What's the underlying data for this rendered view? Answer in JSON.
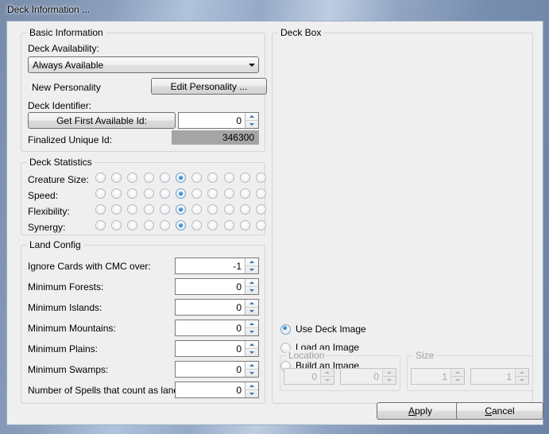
{
  "window": {
    "title": "Deck Information ..."
  },
  "basic_information": {
    "legend": "Basic Information",
    "availability_label": "Deck Availability:",
    "availability_value": "Always Available",
    "personality_label": "New Personality",
    "edit_personality_button": "Edit Personality ...",
    "deck_identifier_label": "Deck Identifier:",
    "get_first_available_button": "Get First Available Id:",
    "deck_identifier_value": "0",
    "finalized_label": "Finalized Unique Id:",
    "finalized_value": "346300"
  },
  "deck_statistics": {
    "legend": "Deck Statistics",
    "columns": 11,
    "rows": [
      {
        "label": "Creature Size:",
        "selected_index": 5
      },
      {
        "label": "Speed:",
        "selected_index": 5
      },
      {
        "label": "Flexibility:",
        "selected_index": 5
      },
      {
        "label": "Synergy:",
        "selected_index": 5
      }
    ]
  },
  "land_config": {
    "legend": "Land Config",
    "fields": [
      {
        "label": "Ignore Cards with CMC over:",
        "value": "-1"
      },
      {
        "label": "Minimum Forests:",
        "value": "0"
      },
      {
        "label": "Minimum Islands:",
        "value": "0"
      },
      {
        "label": "Minimum Mountains:",
        "value": "0"
      },
      {
        "label": "Minimum Plains:",
        "value": "0"
      },
      {
        "label": "Minimum Swamps:",
        "value": "0"
      },
      {
        "label": "Number of Spells that count as land:",
        "value": "0"
      }
    ]
  },
  "deck_box": {
    "legend": "Deck Box",
    "image_options": [
      {
        "label": "Use Deck Image",
        "selected": true
      },
      {
        "label": "Load an Image",
        "selected": false
      },
      {
        "label": "Build an Image",
        "selected": false
      }
    ],
    "location": {
      "legend": "Location",
      "x": "0",
      "y": "0",
      "enabled": false
    },
    "size": {
      "legend": "Size",
      "width": "1",
      "height": "1",
      "enabled": false
    }
  },
  "footer": {
    "apply_button": "Apply",
    "apply_accel": "A",
    "cancel_button": "Cancel",
    "cancel_accel": "C"
  },
  "colors": {
    "dialog_background": "#efefef",
    "radio_selected": "#2a7fc0",
    "readonly_field": "#a5a5a5",
    "group_border": "#d4d4d4"
  }
}
